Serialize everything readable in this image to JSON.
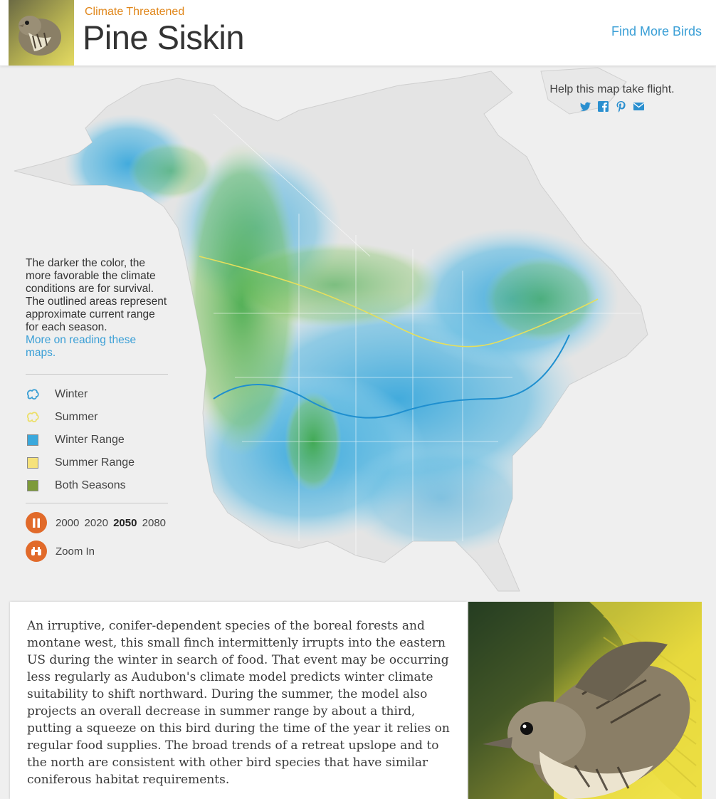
{
  "header": {
    "status": "Climate Threatened",
    "title": "Pine Siskin",
    "find_more": "Find More Birds"
  },
  "share": {
    "title": "Help this map take flight.",
    "icons": [
      "twitter-icon",
      "facebook-icon",
      "pinterest-icon",
      "email-icon"
    ]
  },
  "legend": {
    "description": "The darker the color, the more favorable the climate conditions are for survival. The outlined areas represent approximate current range for each season.",
    "link": "More on reading these maps.",
    "items": [
      {
        "label": "Winter",
        "icon": "winter-outline-icon",
        "color": "#3b9fd4"
      },
      {
        "label": "Summer",
        "icon": "summer-outline-icon",
        "color": "#ecdf6a"
      },
      {
        "label": "Winter Range",
        "icon": "winter-range-swatch",
        "color": "#3aa8dc"
      },
      {
        "label": "Summer Range",
        "icon": "summer-range-swatch",
        "color": "#f6e27a"
      },
      {
        "label": "Both Seasons",
        "icon": "both-seasons-swatch",
        "color": "#7d9a3a"
      }
    ],
    "years": [
      "2000",
      "2020",
      "2050",
      "2080"
    ],
    "active_year": "2050",
    "zoom_label": "Zoom In"
  },
  "description": "An irruptive, conifer-dependent species of the boreal forests and montane west, this small finch intermittenly irrupts into the eastern US during the winter in search of food. That event may be occurring less regularly as Audubon's climate model predicts winter climate suitability to shift northward. During the summer, the model also projects an overall decrease in summer range by about a third, putting a squeeze on this bird during the time of the year it relies on regular food supplies. The broad trends of a retreat upslope and to the north are consistent with other bird species that have similar coniferous habitat requirements.",
  "colors": {
    "accent": "#e0861a",
    "link": "#3a9fd6",
    "control": "#e16a2a",
    "map_land": "#e4e4e4",
    "winter": "#3aa8dc",
    "summer_green": "#3fa845"
  }
}
